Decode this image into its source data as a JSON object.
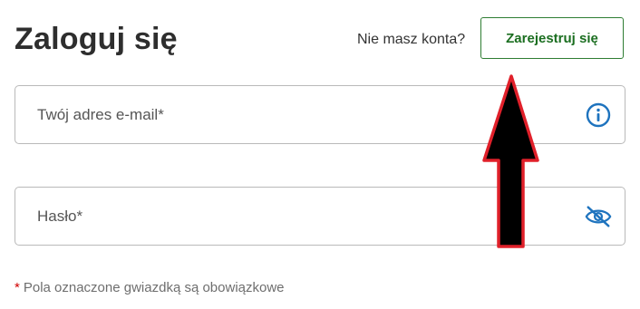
{
  "header": {
    "title": "Zaloguj się",
    "no_account_text": "Nie masz konta?",
    "register_label": "Zarejestruj się"
  },
  "form": {
    "email": {
      "placeholder": "Twój adres e-mail*",
      "value": "",
      "icon": "info-icon"
    },
    "password": {
      "placeholder": "Hasło*",
      "value": "",
      "icon": "eye-off-icon"
    }
  },
  "footer": {
    "required_marker": "*",
    "required_note": "Pola oznaczone gwiazdką są obowiązkowe"
  },
  "colors": {
    "accent_green": "#2e7d32",
    "icon_blue": "#1e73be",
    "required_red": "#d00000",
    "annotation_arrow_fill": "#000000",
    "annotation_arrow_outline": "#e0202a"
  }
}
